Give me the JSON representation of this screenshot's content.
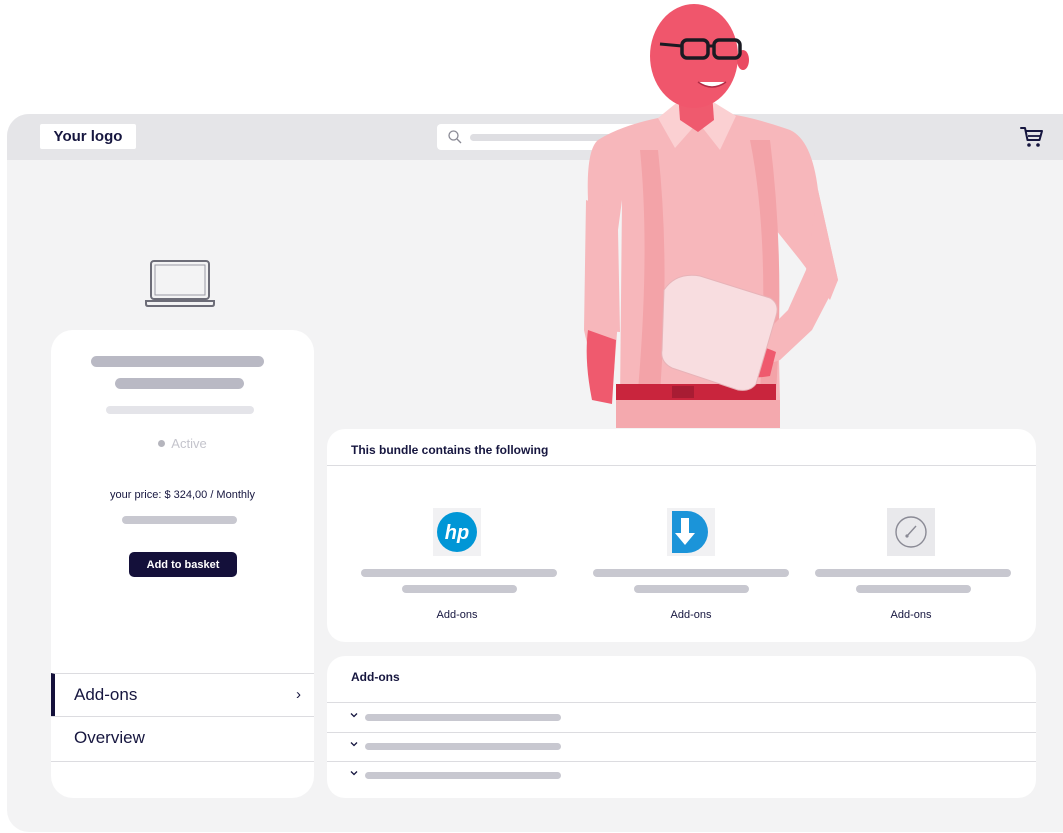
{
  "header": {
    "logo_text": "Your logo",
    "search": {
      "icon": "search-icon"
    },
    "cart": {
      "icon": "cart-icon"
    }
  },
  "product": {
    "icon": "laptop-icon",
    "status_label": "Active",
    "price_text": "your price: $ 324,00 / Monthly",
    "add_button_label": "Add to basket"
  },
  "side_nav": {
    "items": [
      {
        "label": "Add-ons",
        "active": true,
        "chevron": "›"
      },
      {
        "label": "Overview",
        "active": false
      }
    ]
  },
  "bundle": {
    "title": "This bundle contains the following",
    "items": [
      {
        "icon": "hp-logo-icon",
        "label": "Add-ons"
      },
      {
        "icon": "download-arrow-icon",
        "label": "Add-ons"
      },
      {
        "icon": "gauge-icon",
        "label": "Add-ons"
      }
    ]
  },
  "addons": {
    "title": "Add-ons",
    "rows": [
      {
        "icon": "chevron-down-icon"
      },
      {
        "icon": "chevron-down-icon"
      },
      {
        "icon": "chevron-down-icon"
      }
    ]
  },
  "colors": {
    "accent_dark": "#14103a",
    "background": "#f3f3f4",
    "topbar": "#e5e5e8",
    "photo_tint": "#f0566c"
  }
}
